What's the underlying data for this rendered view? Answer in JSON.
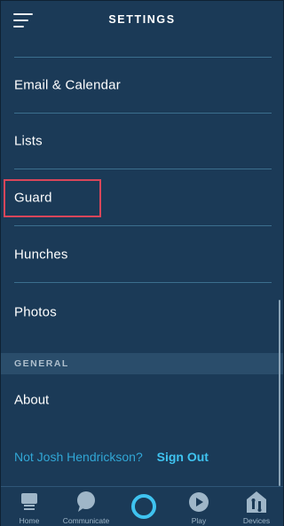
{
  "header": {
    "title": "SETTINGS",
    "menu_icon": "hamburger-menu-icon"
  },
  "settings_items": [
    {
      "label": "Email & Calendar"
    },
    {
      "label": "Lists"
    },
    {
      "label": "Guard"
    },
    {
      "label": "Hunches"
    },
    {
      "label": "Photos"
    }
  ],
  "section": {
    "general_label": "GENERAL"
  },
  "general_items": [
    {
      "label": "About"
    }
  ],
  "account": {
    "prompt": "Not Josh Hendrickson?",
    "signout_label": "Sign Out"
  },
  "tabbar": {
    "tabs": [
      {
        "label": "Home",
        "icon": "home-icon"
      },
      {
        "label": "Communicate",
        "icon": "chat-bubble-icon"
      },
      {
        "label": "",
        "icon": "alexa-ring-icon"
      },
      {
        "label": "Play",
        "icon": "play-icon"
      },
      {
        "label": "Devices",
        "icon": "devices-icon"
      }
    ]
  },
  "colors": {
    "background": "#1b3a57",
    "divider": "#3c6f8e",
    "accent": "#3fc3f0",
    "highlight_box": "#d9465a"
  }
}
